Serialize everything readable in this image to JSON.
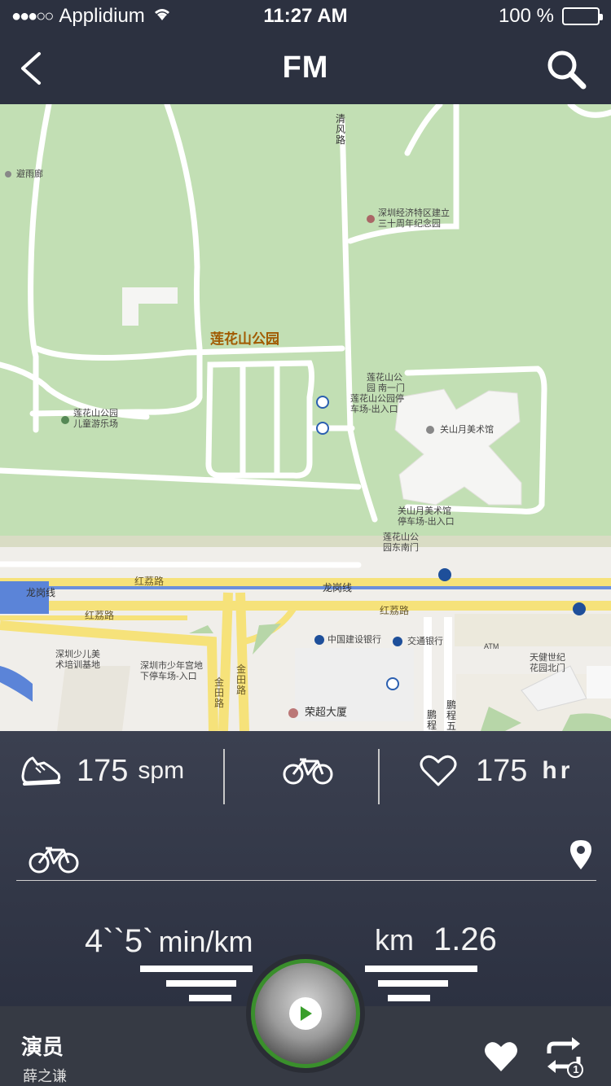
{
  "status_bar": {
    "signal": "●●●○○",
    "carrier": "Applidium",
    "time": "11:27 AM",
    "battery": "100 %"
  },
  "nav": {
    "title": "FM"
  },
  "map": {
    "labels": {
      "bishuilang": "避雨廊",
      "qingfeng_road": "清\n风\n路",
      "memorial_park": "深圳经济特区建立\n三十周年纪念园",
      "lianhuashan_park": "莲花山公园",
      "south_gate_1": "莲花山公\n园 南一门",
      "park_parking": "莲花山公园停\n车场-出入口",
      "guanshanyue_museum": "关山月美术馆",
      "museum_parking": "关山月美术馆\n停车场-出入口",
      "southeast_gate": "莲花山公\n园东南门",
      "childrens_playground": "莲花山公园\n儿童游乐场",
      "honglizhi_road_1": "红荔路",
      "longgang_line_1": "龙岗线",
      "longgang_line_2": "龙岗线",
      "honglizhi_road_2": "红荔路",
      "honglizhi_road_3": "红荔路",
      "childrens_art": "深圳少儿美\n术培训基地",
      "youth_palace_parking": "深圳市少年宫地\n下停车场-入口",
      "jintian_road_1": "金\n田\n路",
      "jintian_road_2": "金\n田\n路",
      "ccb": "中国建设银行",
      "bocom": "交通银行",
      "atm": "ATM",
      "rongchao": "荣超大厦",
      "pengcheng": "鹏\n程",
      "pengcheng_5": "鹏\n程\n五",
      "tianjian": "天健世纪\n花园北门"
    }
  },
  "stats": {
    "cadence_value": "175",
    "cadence_unit": "spm",
    "heart_value": "175",
    "heart_unit": "hr",
    "pace_value": "4``5`",
    "pace_unit": "min/km",
    "distance_unit": "km",
    "distance_value": "1.26"
  },
  "player": {
    "song_title": "演员",
    "song_artist": "薛之谦",
    "repeat_count": "1"
  }
}
